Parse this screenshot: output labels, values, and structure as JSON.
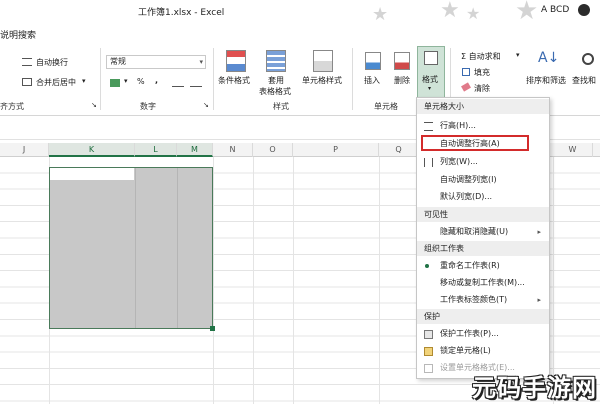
{
  "titlebar": {
    "title": "工作簿1.xlsx - Excel",
    "user": "A BCD"
  },
  "tellme": {
    "label": "说明搜索"
  },
  "ribbon": {
    "alignment": {
      "wrap_text": "自动换行",
      "merge_center": "合并后居中",
      "group_label": "齐方式"
    },
    "number": {
      "format_value": "常规",
      "percent": "%",
      "comma": ",",
      "group_label": "数字"
    },
    "styles": {
      "conditional": "条件格式",
      "table_line1": "套用",
      "table_line2": "表格格式",
      "cell_styles": "单元格样式",
      "group_label": "样式"
    },
    "cells": {
      "insert": "插入",
      "delete": "删除",
      "format": "格式",
      "group_label": "单元格"
    },
    "editing": {
      "autosum": "Σ 自动求和",
      "fill": "填充",
      "clear": "清除",
      "sort_filter": "排序和筛选",
      "find_select": "查找和"
    }
  },
  "columns": [
    "J",
    "K",
    "L",
    "M",
    "N",
    "O",
    "P",
    "Q",
    "W"
  ],
  "menu": {
    "sections": {
      "cell_size": "单元格大小",
      "visibility": "可见性",
      "organize": "组织工作表",
      "protection": "保护"
    },
    "items": {
      "row_height": "行高(H)...",
      "autofit_row": "自动调整行高(A)",
      "col_width": "列宽(W)...",
      "autofit_col": "自动调整列宽(I)",
      "default_width": "默认列宽(D)...",
      "hide_unhide": "隐藏和取消隐藏(U)",
      "rename": "重命名工作表(R)",
      "move_copy": "移动或复制工作表(M)...",
      "tab_color": "工作表标签颜色(T)",
      "protect_sheet": "保护工作表(P)...",
      "lock_cell": "锁定单元格(L)",
      "format_cells": "设置单元格格式(E)..."
    }
  },
  "watermark": "元码手游网",
  "colors": {
    "accent": "#217346",
    "highlight": "#d32b2b",
    "selection_fill": "#c8c8c8"
  }
}
